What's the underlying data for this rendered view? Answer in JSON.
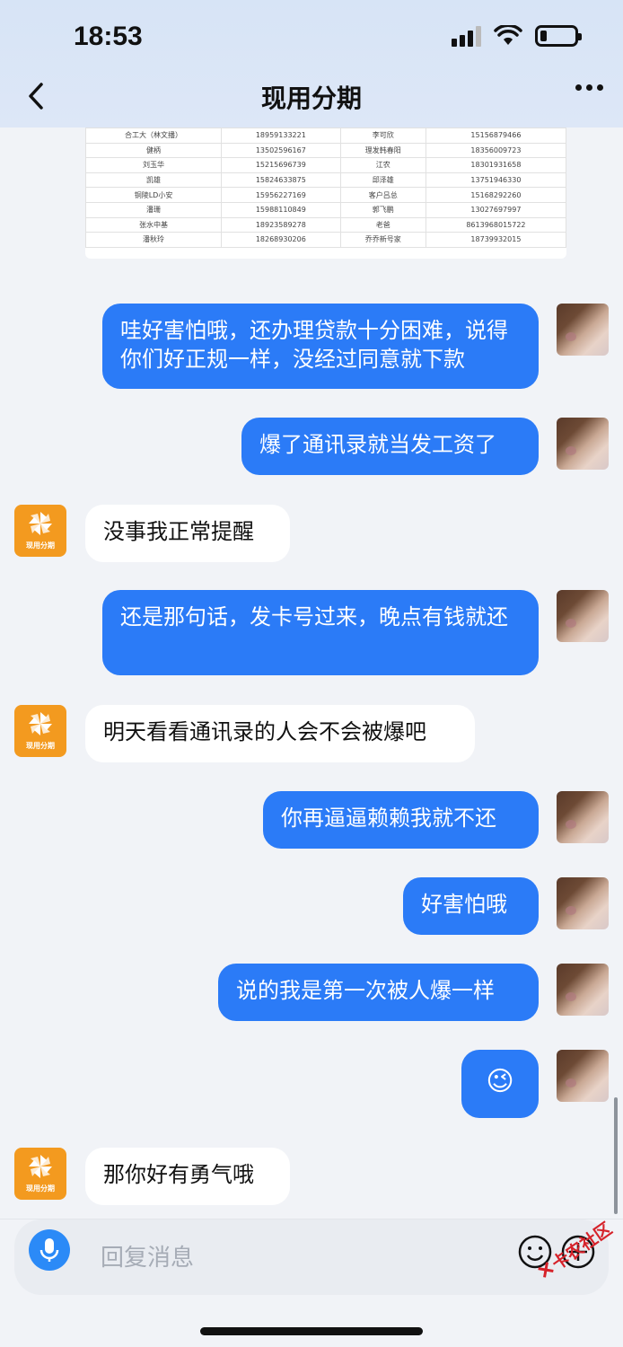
{
  "status_bar": {
    "time": "18:53"
  },
  "nav": {
    "title": "现用分期"
  },
  "contacts_table": [
    [
      "合工大（林文播）",
      "18959133221",
      "李可欣",
      "15156879466"
    ],
    [
      "健柄",
      "13502596167",
      "理发韩春阳",
      "18356009723"
    ],
    [
      "刘玉华",
      "15215696739",
      "江农",
      "18301931658"
    ],
    [
      "凯雄",
      "15824633875",
      "邱泽雄",
      "13751946330"
    ],
    [
      "铜陵LD小安",
      "15956227169",
      "客户吕总",
      "15168292260"
    ],
    [
      "潘珊",
      "15988110849",
      "郭飞鹏",
      "13027697997"
    ],
    [
      "张水中基",
      "18923589278",
      "老爸",
      "8613968015722"
    ],
    [
      "潘秋玲",
      "18268930206",
      "乔乔新号家",
      "18739932015"
    ]
  ],
  "messages": [
    {
      "from": "me",
      "text": "哇好害怕哦，还办理贷款十分困难，说得你们好正规一样，没经过同意就下款"
    },
    {
      "from": "me",
      "text": "爆了通讯录就当发工资了"
    },
    {
      "from": "them",
      "text": "没事我正常提醒"
    },
    {
      "from": "me",
      "text": "还是那句话，发卡号过来，晚点有钱就还"
    },
    {
      "from": "them",
      "text": "明天看看通讯录的人会不会被爆吧"
    },
    {
      "from": "me",
      "text": "你再逼逼赖赖我就不还"
    },
    {
      "from": "me",
      "text": "好害怕哦"
    },
    {
      "from": "me",
      "text": "说的我是第一次被人爆一样"
    },
    {
      "from": "me",
      "text": "😉"
    },
    {
      "from": "them",
      "text": "那你好有勇气哦"
    }
  ],
  "bot_avatar_label": "现用分期",
  "input": {
    "placeholder": "回复消息"
  },
  "watermark": "卡农社区",
  "colors": {
    "my_bubble": "#2b7bf7",
    "bot_avatar": "#f39a1f",
    "header": "#d7e4f6"
  }
}
